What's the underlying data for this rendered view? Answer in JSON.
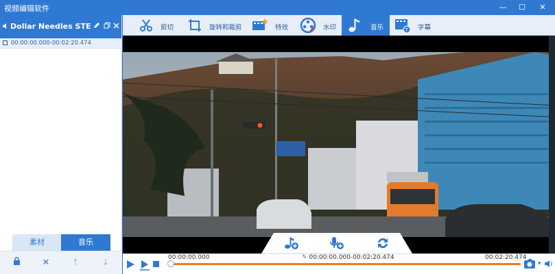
{
  "window": {
    "title": "视频编辑软件",
    "minimize": "—",
    "maximize": "☐",
    "close": "✕"
  },
  "clip": {
    "name": "Dollar Needles STEMS…",
    "time_range": "00:00:00.000-00:02:20.474"
  },
  "left_tabs": {
    "material": "素材",
    "music": "音乐"
  },
  "left_actions": {
    "delete": "✕",
    "up": "↑",
    "down": "↓"
  },
  "toolbar": {
    "items": [
      {
        "label": "剪切",
        "icon": "cut-icon"
      },
      {
        "label": "旋转和裁剪",
        "icon": "rotate-crop-icon"
      },
      {
        "label": "特效",
        "icon": "effects-icon"
      },
      {
        "label": "水印",
        "icon": "watermark-icon"
      },
      {
        "label": "音乐",
        "icon": "music-icon",
        "active": true
      },
      {
        "label": "字幕",
        "icon": "subtitle-icon"
      }
    ]
  },
  "player": {
    "current_time": "00:00:00.000",
    "range": "00:00:00.000-00:02:20.474",
    "end_time": "00:02:20.474",
    "progress_fraction": 0.0
  },
  "colors": {
    "accent": "#2f79d3",
    "progress": "#f07a1e",
    "toolbar_bg": "#e7eef8"
  }
}
